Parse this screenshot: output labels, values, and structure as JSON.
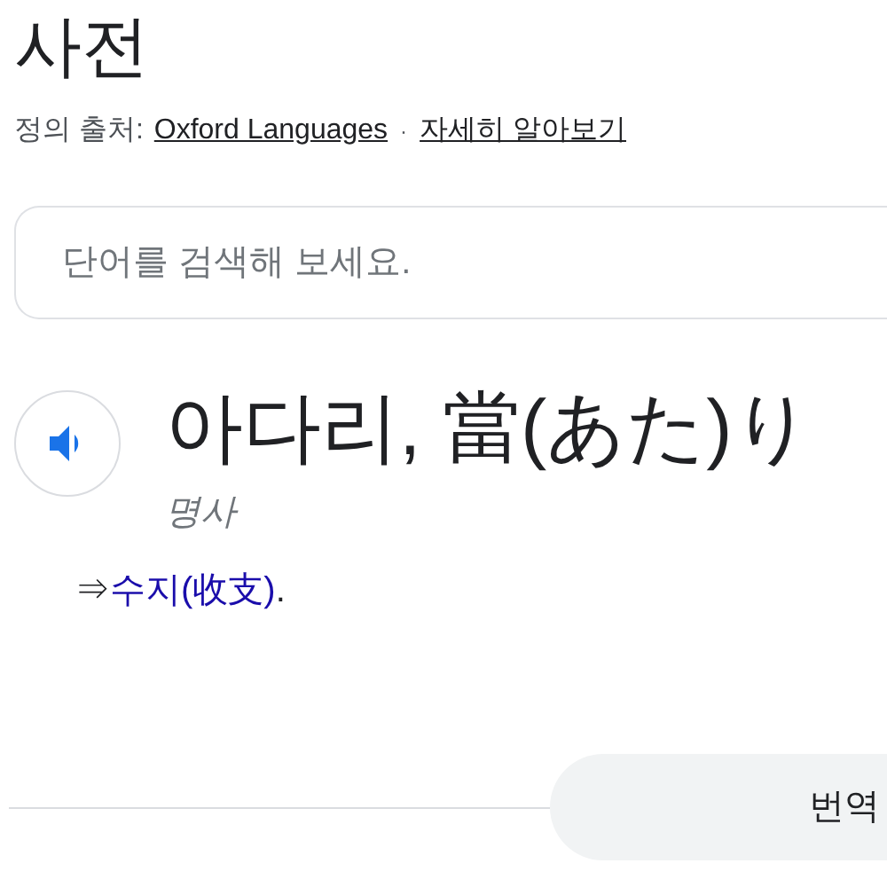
{
  "title": "사전",
  "source": {
    "label": "정의 출처:",
    "link": "Oxford Languages",
    "separator": "·",
    "more_link": "자세히 알아보기"
  },
  "search": {
    "placeholder": "단어를 검색해 보세요."
  },
  "entry": {
    "headword": "아다리, 當(あた)り",
    "part_of_speech": "명사",
    "definition": {
      "prefix": "⇒",
      "link": "수지(收支)",
      "suffix": "."
    }
  },
  "translate_button": {
    "label": "번역"
  }
}
